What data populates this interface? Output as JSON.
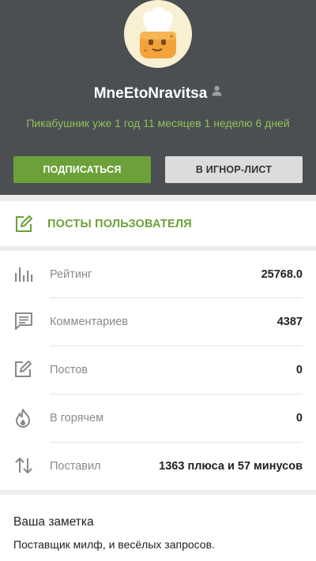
{
  "profile": {
    "username": "MneEtoNravitsa",
    "since": "Пикабушник уже 1 год 11 месяцев 1 неделю 6 дней",
    "avatar_icon": "chef-cookie-avatar",
    "user_icon": "user-icon"
  },
  "actions": {
    "subscribe_label": "ПОДПИСАТЬСЯ",
    "ignore_label": "В ИГНОР-ЛИСТ"
  },
  "posts_link": {
    "label": "ПОСТЫ ПОЛЬЗОВАТЕЛЯ",
    "icon": "edit-icon"
  },
  "stats": [
    {
      "icon": "bar-chart-icon",
      "label": "Рейтинг",
      "value": "25768.0"
    },
    {
      "icon": "comment-icon",
      "label": "Комментариев",
      "value": "4387"
    },
    {
      "icon": "edit-icon",
      "label": "Постов",
      "value": "0"
    },
    {
      "icon": "flame-icon",
      "label": "В горячем",
      "value": "0"
    },
    {
      "icon": "sort-arrows-icon",
      "label": "Поставил",
      "value": "1363 плюса и 57 минусов"
    }
  ],
  "note": {
    "title": "Ваша заметка",
    "text": "Поставщик милф, и весёлых запросов."
  },
  "colors": {
    "header_bg": "#4b4f52",
    "accent_green": "#6ca139",
    "since_text": "#8fc159",
    "ignore_button": "#dcdcdc",
    "page_bg": "#ededed"
  }
}
